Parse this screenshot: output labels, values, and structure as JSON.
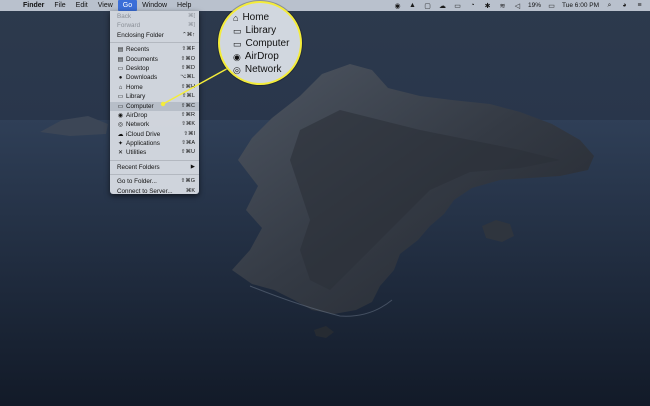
{
  "menubar": {
    "items": [
      {
        "label": "Finder",
        "bold": true
      },
      {
        "label": "File"
      },
      {
        "label": "Edit"
      },
      {
        "label": "View"
      },
      {
        "label": "Go",
        "active": true
      },
      {
        "label": "Window"
      },
      {
        "label": "Help"
      }
    ],
    "status": {
      "battery": "19%",
      "datetime": "Tue 6:00 PM"
    }
  },
  "go_menu": {
    "items": [
      {
        "label": "Back",
        "shortcut": "⌘[",
        "disabled": true
      },
      {
        "label": "Forward",
        "shortcut": "⌘]",
        "disabled": true
      },
      {
        "label": "Enclosing Folder",
        "shortcut": "⌃⌘↑"
      },
      {
        "separator": true
      },
      {
        "label": "Recents",
        "shortcut": "⇧⌘F",
        "icon": "recents-icon",
        "glyph": "▤"
      },
      {
        "label": "Documents",
        "shortcut": "⇧⌘O",
        "icon": "documents-icon",
        "glyph": "▤"
      },
      {
        "label": "Desktop",
        "shortcut": "⇧⌘D",
        "icon": "desktop-icon",
        "glyph": "▭"
      },
      {
        "label": "Downloads",
        "shortcut": "⌥⌘L",
        "icon": "downloads-icon",
        "glyph": "●"
      },
      {
        "label": "Home",
        "shortcut": "⇧⌘H",
        "icon": "home-icon",
        "glyph": "⌂"
      },
      {
        "label": "Library",
        "shortcut": "⇧⌘L",
        "icon": "library-icon",
        "glyph": "▭"
      },
      {
        "label": "Computer",
        "shortcut": "⇧⌘C",
        "icon": "computer-icon",
        "glyph": "▭",
        "highlight": true
      },
      {
        "label": "AirDrop",
        "shortcut": "⇧⌘R",
        "icon": "airdrop-icon",
        "glyph": "◉"
      },
      {
        "label": "Network",
        "shortcut": "⇧⌘K",
        "icon": "network-icon",
        "glyph": "◎"
      },
      {
        "label": "iCloud Drive",
        "shortcut": "⇧⌘I",
        "icon": "icloud-icon",
        "glyph": "☁"
      },
      {
        "label": "Applications",
        "shortcut": "⇧⌘A",
        "icon": "applications-icon",
        "glyph": "✦"
      },
      {
        "label": "Utilities",
        "shortcut": "⇧⌘U",
        "icon": "utilities-icon",
        "glyph": "✕"
      },
      {
        "separator": true
      },
      {
        "label": "Recent Folders",
        "shortcut": "▶"
      },
      {
        "separator": true
      },
      {
        "label": "Go to Folder...",
        "shortcut": "⇧⌘G"
      },
      {
        "label": "Connect to Server...",
        "shortcut": "⌘K"
      }
    ]
  },
  "zoom_callout": {
    "items": [
      {
        "label": "Home",
        "icon": "home-icon"
      },
      {
        "label": "Library",
        "icon": "library-icon"
      },
      {
        "label": "Computer",
        "icon": "computer-icon"
      },
      {
        "label": "AirDrop",
        "icon": "airdrop-icon"
      },
      {
        "label": "Network",
        "icon": "network-icon"
      }
    ],
    "accent_color": "#f4ec3a"
  }
}
